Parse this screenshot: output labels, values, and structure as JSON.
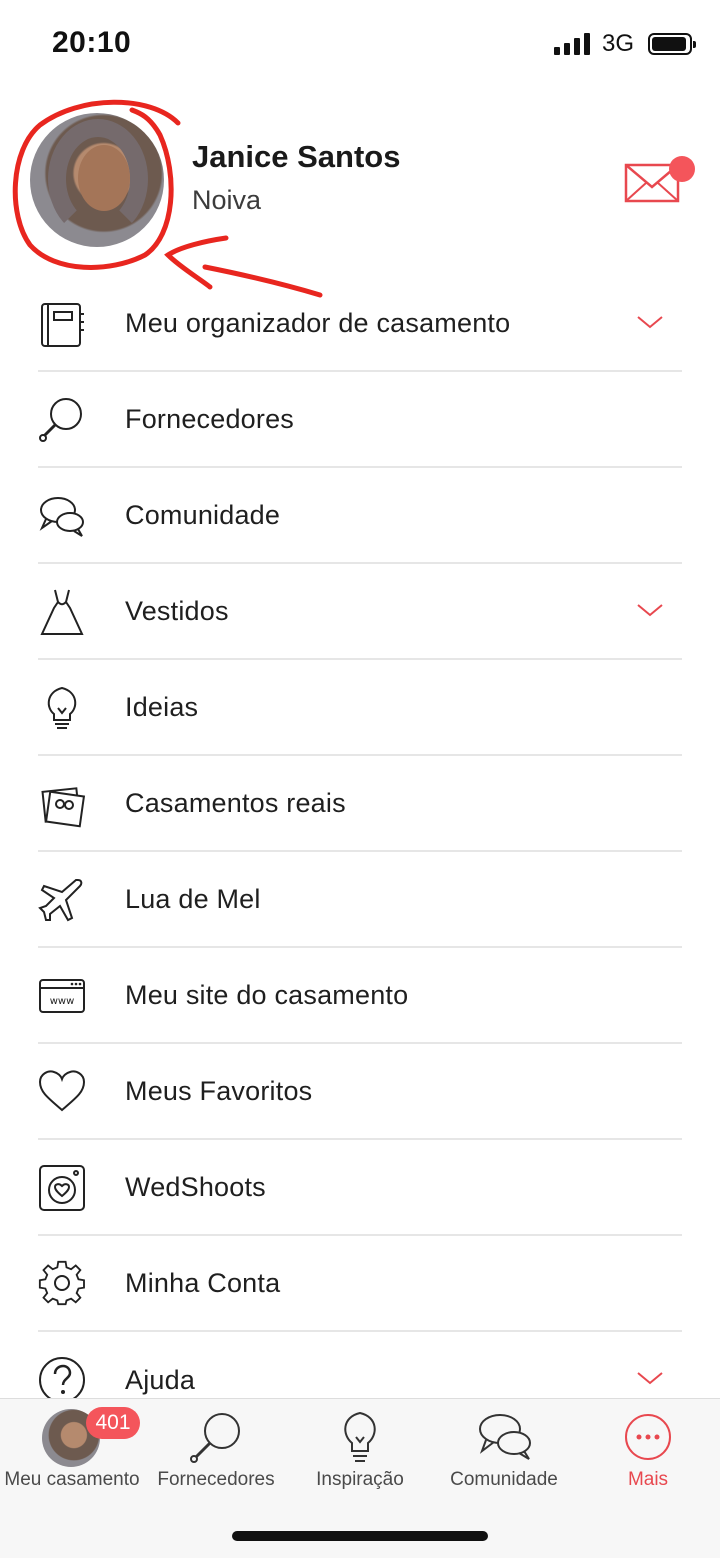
{
  "status_bar": {
    "time": "20:10",
    "network": "3G"
  },
  "profile": {
    "name": "Janice Santos",
    "role": "Noiva"
  },
  "menu": {
    "items": [
      {
        "label": "Meu organizador de casamento",
        "icon": "planner-notebook-icon",
        "expandable": true
      },
      {
        "label": "Fornecedores",
        "icon": "magnifier-icon",
        "expandable": false
      },
      {
        "label": "Comunidade",
        "icon": "chat-bubbles-icon",
        "expandable": false
      },
      {
        "label": "Vestidos",
        "icon": "dress-icon",
        "expandable": true
      },
      {
        "label": "Ideias",
        "icon": "lightbulb-icon",
        "expandable": false
      },
      {
        "label": "Casamentos reais",
        "icon": "photos-icon",
        "expandable": false
      },
      {
        "label": "Lua de Mel",
        "icon": "airplane-icon",
        "expandable": false
      },
      {
        "label": "Meu site do casamento",
        "icon": "website-icon",
        "expandable": false
      },
      {
        "label": "Meus Favoritos",
        "icon": "heart-icon",
        "expandable": false
      },
      {
        "label": "WedShoots",
        "icon": "camera-heart-icon",
        "expandable": false
      },
      {
        "label": "Minha Conta",
        "icon": "gear-icon",
        "expandable": false
      },
      {
        "label": "Ajuda",
        "icon": "help-icon",
        "expandable": true
      }
    ]
  },
  "tabbar": {
    "tabs": [
      {
        "label": "Meu casamento",
        "icon": "avatar",
        "badge": "401"
      },
      {
        "label": "Fornecedores",
        "icon": "magnifier-icon"
      },
      {
        "label": "Inspiração",
        "icon": "lightbulb-icon"
      },
      {
        "label": "Comunidade",
        "icon": "chat-bubbles-icon"
      },
      {
        "label": "Mais",
        "icon": "more-dots-icon",
        "active": true
      }
    ]
  },
  "colors": {
    "accent": "#e8484f",
    "annotation": "#e8261f",
    "divider": "#e6e6e6"
  }
}
